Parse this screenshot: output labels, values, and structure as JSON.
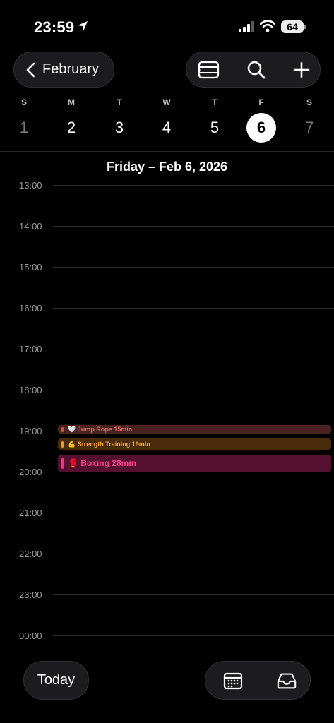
{
  "status_bar": {
    "time": "23:59",
    "battery": "64",
    "icons": [
      "location-arrow-icon",
      "cellular-signal-icon",
      "wifi-icon",
      "battery-icon"
    ]
  },
  "nav": {
    "back_label": "February",
    "tools": [
      "list-view-icon",
      "search-icon",
      "add-icon"
    ]
  },
  "week": {
    "days": [
      {
        "dow": "S",
        "date": "1",
        "state": "dim"
      },
      {
        "dow": "M",
        "date": "2",
        "state": "normal"
      },
      {
        "dow": "T",
        "date": "3",
        "state": "normal"
      },
      {
        "dow": "W",
        "date": "4",
        "state": "normal"
      },
      {
        "dow": "T",
        "date": "5",
        "state": "normal"
      },
      {
        "dow": "F",
        "date": "6",
        "state": "selected"
      },
      {
        "dow": "S",
        "date": "7",
        "state": "dim"
      }
    ]
  },
  "day_title": "Friday – Feb 6, 2026",
  "timeline": {
    "hours": [
      "13:00",
      "14:00",
      "15:00",
      "16:00",
      "17:00",
      "18:00",
      "19:00",
      "20:00",
      "21:00",
      "22:00",
      "23:00",
      "00:00"
    ]
  },
  "events": [
    {
      "emoji": "🤍",
      "title": "Jump Rope 15min",
      "color": "#e0503f"
    },
    {
      "emoji": "💪",
      "title": "Strength Training 19min",
      "color": "#f29a2a"
    },
    {
      "emoji": "🥊",
      "title": "Boxing 28min",
      "color": "#ff2d87"
    }
  ],
  "bottom": {
    "today_label": "Today",
    "buttons": [
      "calendar-icon",
      "inbox-icon"
    ]
  }
}
